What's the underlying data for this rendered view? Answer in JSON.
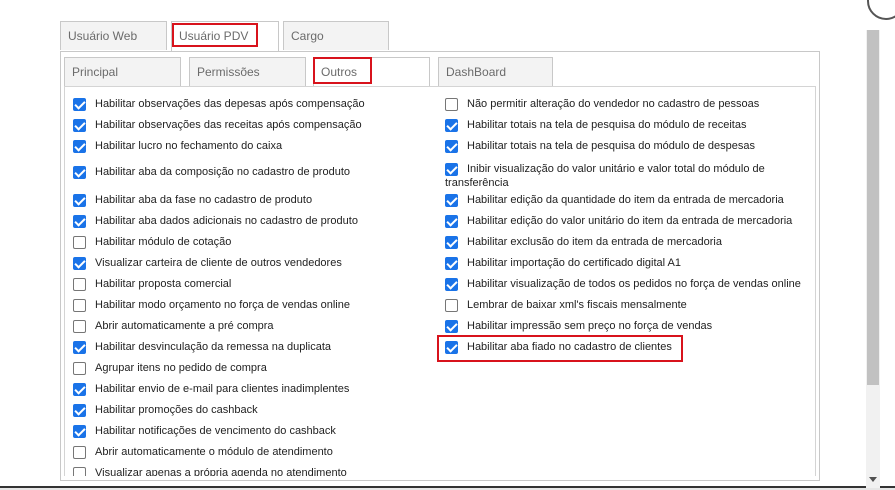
{
  "outer_tabs": [
    {
      "label": "Usuário Web",
      "active": false
    },
    {
      "label": "Usuário PDV",
      "active": true
    },
    {
      "label": "Cargo",
      "active": false
    }
  ],
  "inner_tabs": [
    {
      "label": "Principal",
      "active": false
    },
    {
      "label": "Permissões",
      "active": false
    },
    {
      "label": "Outros",
      "active": true
    },
    {
      "label": "DashBoard",
      "active": false
    }
  ],
  "left_options": [
    {
      "label": "Habilitar observações das depesas após compensação",
      "checked": true
    },
    {
      "label": "Habilitar observações das receitas após compensação",
      "checked": true
    },
    {
      "label": "Habilitar lucro no fechamento do caixa",
      "checked": true
    },
    {
      "label": "Habilitar aba da composição no cadastro de produto",
      "checked": true
    },
    {
      "label": "Habilitar aba da fase no cadastro de produto",
      "checked": true
    },
    {
      "label": "Habilitar aba dados adicionais no cadastro de produto",
      "checked": true
    },
    {
      "label": "Habilitar módulo de cotação",
      "checked": false
    },
    {
      "label": "Visualizar carteira de cliente de outros vendedores",
      "checked": true
    },
    {
      "label": "Habilitar proposta comercial",
      "checked": false
    },
    {
      "label": "Habilitar modo orçamento no força de vendas online",
      "checked": false
    },
    {
      "label": "Abrir automaticamente a pré compra",
      "checked": false
    },
    {
      "label": "Habilitar desvinculação da remessa na duplicata",
      "checked": true
    },
    {
      "label": "Agrupar itens no pedido de compra",
      "checked": false
    },
    {
      "label": "Habilitar envio de e-mail para clientes inadimplentes",
      "checked": true
    },
    {
      "label": "Habilitar promoções do cashback",
      "checked": true
    },
    {
      "label": "Habilitar notificações de vencimento do cashback",
      "checked": true
    },
    {
      "label": "Abrir automaticamente o módulo de atendimento",
      "checked": false
    },
    {
      "label": "Visualizar apenas a própria agenda no atendimento",
      "checked": false
    }
  ],
  "right_options": [
    {
      "label": "Não permitir alteração do vendedor no cadastro de pessoas",
      "checked": false
    },
    {
      "label": "Habilitar totais na tela de pesquisa do módulo de receitas",
      "checked": true
    },
    {
      "label": "Habilitar totais na tela de pesquisa do módulo de despesas",
      "checked": true
    },
    {
      "label": "Inibir visualização do valor unitário e valor total do módulo de transferência",
      "checked": true
    },
    {
      "label": "Habilitar edição da quantidade do item da entrada de mercadoria",
      "checked": true
    },
    {
      "label": "Habilitar edição do valor unitário do item da entrada de mercadoria",
      "checked": true
    },
    {
      "label": "Habilitar exclusão do item da entrada de mercadoria",
      "checked": true
    },
    {
      "label": "Habilitar importação do certificado digital A1",
      "checked": true
    },
    {
      "label": "Habilitar visualização de todos os pedidos no força de vendas online",
      "checked": true
    },
    {
      "label": "Lembrar de baixar xml's fiscais mensalmente",
      "checked": false
    },
    {
      "label": "Habilitar impressão sem preço no força de vendas",
      "checked": true
    },
    {
      "label": "Habilitar aba fiado no cadastro de clientes",
      "checked": true
    }
  ],
  "colors": {
    "checkbox_checked": "#1a73e8",
    "highlight": "#d8131c"
  }
}
